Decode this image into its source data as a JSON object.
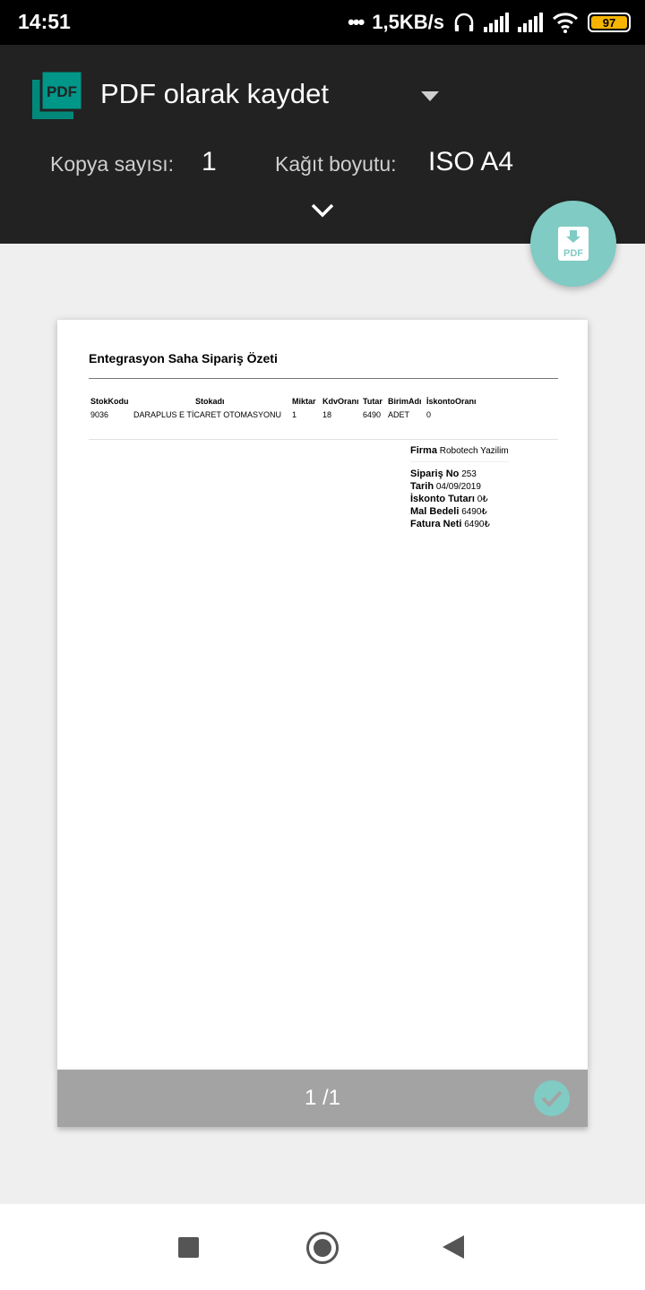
{
  "status_bar": {
    "time": "14:51",
    "dots": "•••",
    "speed": "1,5KB/s",
    "battery": "97"
  },
  "header": {
    "printer_name": "PDF olarak kaydet",
    "icon": "pdf-file-icon",
    "copies_label": "Kopya sayısı:",
    "copies_value": "1",
    "paper_label": "Kağıt boyutu:",
    "paper_value": "ISO A4",
    "accent_color": "#009688"
  },
  "fab": {
    "icon": "pdf-download-icon",
    "icon_text": "PDF",
    "color": "#80cbc4"
  },
  "document": {
    "title": "Entegrasyon Saha Sipariş Özeti",
    "columns": [
      "StokKodu",
      "Stokadı",
      "Miktar",
      "KdvOranı",
      "Tutar",
      "BirimAdı",
      "İskontoOranı"
    ],
    "rows": [
      [
        "9036",
        "DARAPLUS E TİCARET OTOMASYONU",
        "1",
        "18",
        "6490",
        "ADET",
        "0"
      ]
    ],
    "summary": {
      "firma_label": "Firma",
      "firma_value": "Robotech Yazilim",
      "siparis_label": "Sipariş No",
      "siparis_value": "253",
      "tarih_label": "Tarih",
      "tarih_value": "04/09/2019",
      "iskonto_label": "İskonto Tutarı",
      "iskonto_value": "0₺",
      "mal_label": "Mal Bedeli",
      "mal_value": "6490₺",
      "fatura_label": "Fatura Neti",
      "fatura_value": "6490₺"
    }
  },
  "preview_footer": {
    "page_counter": "1 /1",
    "check_color": "#80cbc4"
  },
  "navbar": {
    "recents_icon": "square-recents-icon",
    "home_icon": "circle-home-icon",
    "back_icon": "triangle-back-icon"
  }
}
